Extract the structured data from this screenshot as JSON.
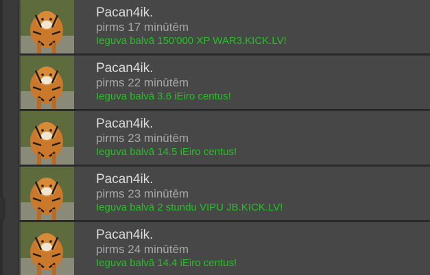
{
  "colors": {
    "background": "#3a3a3a",
    "card": "#474747",
    "name": "#dcdcdc",
    "time": "#a8a8a8",
    "prize": "#22c322"
  },
  "feed": {
    "entries": [
      {
        "avatar_icon": "tiger-avatar-icon",
        "name": "Pacan4ik.",
        "time": "pirms 17 minūtēm",
        "prize": "Ieguva balvā 150'000 XP WAR3.KICK.LV!"
      },
      {
        "avatar_icon": "tiger-avatar-icon",
        "name": "Pacan4ik.",
        "time": "pirms 22 minūtēm",
        "prize": "Ieguva balvā 3.6 iEiro centus!"
      },
      {
        "avatar_icon": "tiger-avatar-icon",
        "name": "Pacan4ik.",
        "time": "pirms 23 minūtēm",
        "prize": "Ieguva balvā 14.5 iEiro centus!"
      },
      {
        "avatar_icon": "tiger-avatar-icon",
        "name": "Pacan4ik.",
        "time": "pirms 23 minūtēm",
        "prize": "Ieguva balvā 2 stundu VIPU JB.KICK.LV!"
      },
      {
        "avatar_icon": "tiger-avatar-icon",
        "name": "Pacan4ik.",
        "time": "pirms 24 minūtēm",
        "prize": "Ieguva balvā 14.4 iEiro centus!"
      }
    ]
  }
}
